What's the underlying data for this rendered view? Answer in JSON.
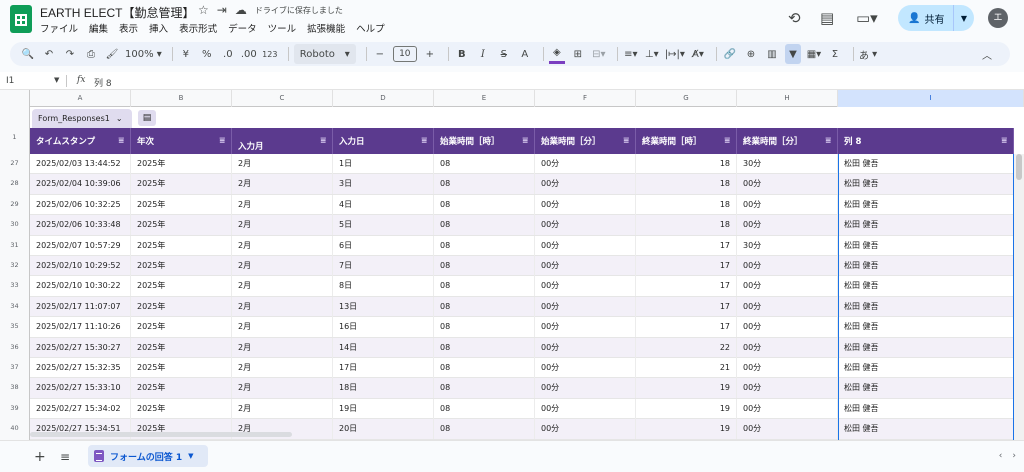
{
  "title_bar": {
    "doc_title": "EARTH ELECT【勤怠管理】",
    "saved_status": "ドライブに保存しました"
  },
  "menus": [
    "ファイル",
    "編集",
    "表示",
    "挿入",
    "表示形式",
    "データ",
    "ツール",
    "拡張機能",
    "ヘルプ"
  ],
  "share": {
    "label": "共有"
  },
  "avatar": {
    "initial": "エ"
  },
  "toolbar": {
    "zoom": "100%",
    "currency": "¥",
    "percent": "%",
    "decimal_decrease": ".0",
    "decimal_increase": ".00",
    "number_format": "123",
    "font": "Roboto",
    "font_size": "10",
    "bold": "B",
    "italic": "I",
    "strike": "S",
    "text_color": "A",
    "text_color_accent": "#7b3fc0",
    "sum": "Σ",
    "input_tools": "あ"
  },
  "formula_bar": {
    "name_box": "I1",
    "content": "列 8"
  },
  "column_letters": [
    "A",
    "B",
    "C",
    "D",
    "E",
    "F",
    "G",
    "H",
    "I"
  ],
  "table": {
    "name": "Form_Responses1",
    "header_color": "#5b3a8e",
    "band_color": "#f3f0f8",
    "headers": [
      "タイムスタンプ",
      "年次",
      "入力月",
      "入力日",
      "始業時間［時］",
      "始業時間［分］",
      "終業時間［時］",
      "終業時間［分］",
      "列 8"
    ]
  },
  "header_row_number": "1",
  "rows": [
    {
      "num": "27",
      "cells": [
        "2025/02/03 13:44:52",
        "2025年",
        "2月",
        "1日",
        "08",
        "00分",
        "18",
        "30分",
        "松田 健吾"
      ]
    },
    {
      "num": "28",
      "cells": [
        "2025/02/04 10:39:06",
        "2025年",
        "2月",
        "3日",
        "08",
        "00分",
        "18",
        "00分",
        "松田 健吾"
      ]
    },
    {
      "num": "29",
      "cells": [
        "2025/02/06 10:32:25",
        "2025年",
        "2月",
        "4日",
        "08",
        "00分",
        "18",
        "00分",
        "松田 健吾"
      ]
    },
    {
      "num": "30",
      "cells": [
        "2025/02/06 10:33:48",
        "2025年",
        "2月",
        "5日",
        "08",
        "00分",
        "18",
        "00分",
        "松田 健吾"
      ]
    },
    {
      "num": "31",
      "cells": [
        "2025/02/07 10:57:29",
        "2025年",
        "2月",
        "6日",
        "08",
        "00分",
        "17",
        "30分",
        "松田 健吾"
      ]
    },
    {
      "num": "32",
      "cells": [
        "2025/02/10 10:29:52",
        "2025年",
        "2月",
        "7日",
        "08",
        "00分",
        "17",
        "00分",
        "松田 健吾"
      ]
    },
    {
      "num": "33",
      "cells": [
        "2025/02/10 10:30:22",
        "2025年",
        "2月",
        "8日",
        "08",
        "00分",
        "17",
        "00分",
        "松田 健吾"
      ]
    },
    {
      "num": "34",
      "cells": [
        "2025/02/17 11:07:07",
        "2025年",
        "2月",
        "13日",
        "08",
        "00分",
        "17",
        "00分",
        "松田 健吾"
      ]
    },
    {
      "num": "35",
      "cells": [
        "2025/02/17 11:10:26",
        "2025年",
        "2月",
        "16日",
        "08",
        "00分",
        "17",
        "00分",
        "松田 健吾"
      ]
    },
    {
      "num": "36",
      "cells": [
        "2025/02/27 15:30:27",
        "2025年",
        "2月",
        "14日",
        "08",
        "00分",
        "22",
        "00分",
        "松田 健吾"
      ]
    },
    {
      "num": "37",
      "cells": [
        "2025/02/27 15:32:35",
        "2025年",
        "2月",
        "17日",
        "08",
        "00分",
        "21",
        "00分",
        "松田 健吾"
      ]
    },
    {
      "num": "38",
      "cells": [
        "2025/02/27 15:33:10",
        "2025年",
        "2月",
        "18日",
        "08",
        "00分",
        "19",
        "00分",
        "松田 健吾"
      ]
    },
    {
      "num": "39",
      "cells": [
        "2025/02/27 15:34:02",
        "2025年",
        "2月",
        "19日",
        "08",
        "00分",
        "19",
        "00分",
        "松田 健吾"
      ]
    },
    {
      "num": "40",
      "cells": [
        "2025/02/27 15:34:51",
        "2025年",
        "2月",
        "20日",
        "08",
        "00分",
        "19",
        "00分",
        "松田 健吾"
      ]
    }
  ],
  "sheet_tab": {
    "label": "フォームの回答 1"
  }
}
